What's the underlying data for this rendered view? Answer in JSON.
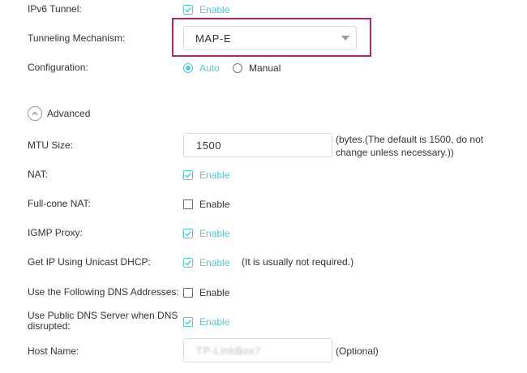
{
  "ipv6_tunnel": {
    "label": "IPv6 Tunnel:",
    "checkbox_label": "Enable",
    "checked": true
  },
  "tunneling_mechanism": {
    "label": "Tunneling Mechanism:",
    "value": "MAP-E"
  },
  "configuration": {
    "label": "Configuration:",
    "options": [
      "Auto",
      "Manual"
    ],
    "selected": "Auto"
  },
  "advanced": {
    "label": "Advanced"
  },
  "mtu": {
    "label": "MTU Size:",
    "value": "1500",
    "hint_line1": "(bytes.(The default is 1500, do not",
    "hint_line2": "change unless necessary.))"
  },
  "nat": {
    "label": "NAT:",
    "checkbox_label": "Enable",
    "checked": true
  },
  "full_cone_nat": {
    "label": "Full-cone NAT:",
    "checkbox_label": "Enable",
    "checked": false
  },
  "igmp_proxy": {
    "label": "IGMP Proxy:",
    "checkbox_label": "Enable",
    "checked": true
  },
  "unicast_dhcp": {
    "label": "Get IP Using Unicast DHCP:",
    "checkbox_label": "Enable",
    "checked": true,
    "hint": "(It is usually not required.)"
  },
  "dns_addresses": {
    "label": "Use the Following DNS Addresses:",
    "checkbox_label": "Enable",
    "checked": false
  },
  "public_dns": {
    "label": "Use Public DNS Server when DNS disrupted:",
    "checkbox_label": "Enable",
    "checked": true
  },
  "host_name": {
    "label": "Host Name:",
    "value": "TP-LinkBox7",
    "hint": "(Optional)"
  },
  "colors": {
    "accent": "#4acbd6",
    "highlight": "#b72467"
  }
}
